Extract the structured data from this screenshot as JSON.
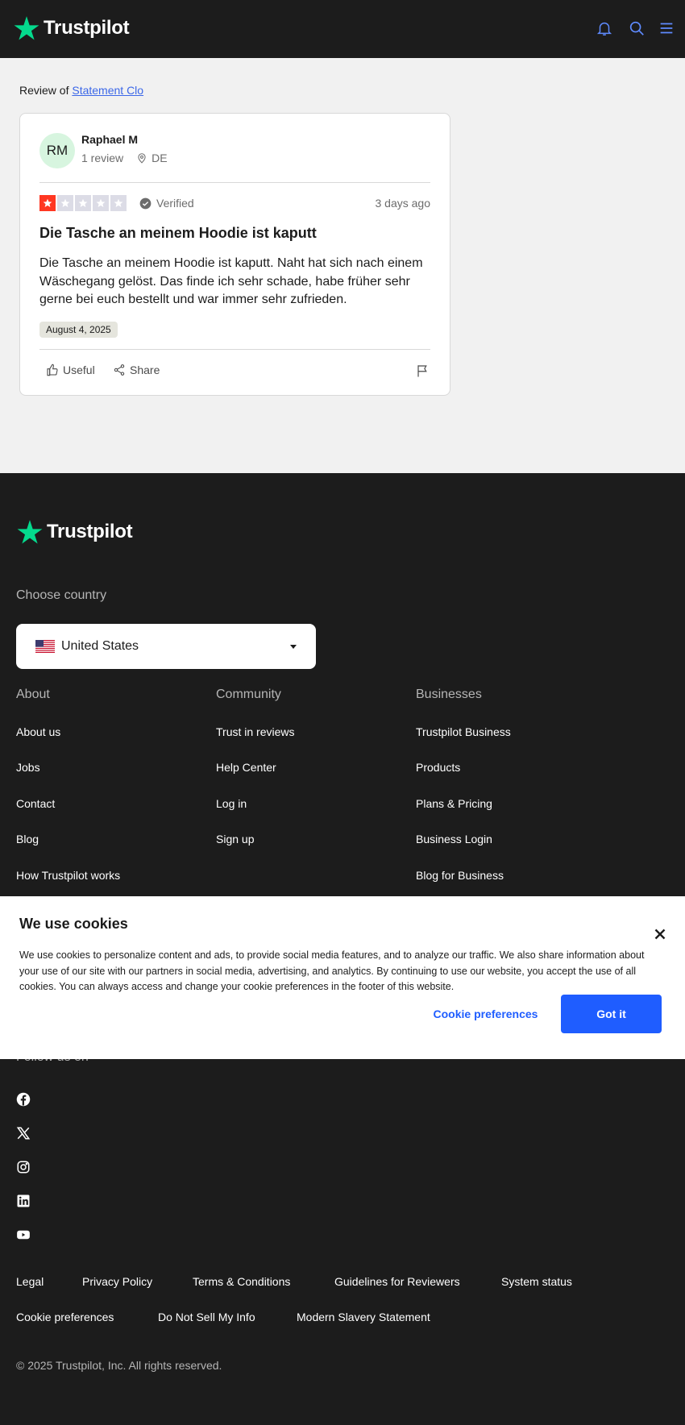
{
  "header": {
    "logo_text": "Trustpilot",
    "icons": [
      "bell-icon",
      "search-icon",
      "menu-icon"
    ],
    "accent_color": "#04da8d"
  },
  "main": {
    "review_of_prefix": "Review of",
    "company_link": "Statement Clo",
    "reviewer": {
      "initials": "RM",
      "name": "Raphael M",
      "review_count": "1 review",
      "country": "DE"
    },
    "rating": 1,
    "rating_max": 5,
    "verified_label": "Verified",
    "posted_ago": "3 days ago",
    "title": "Die Tasche an meinem Hoodie ist kaputt",
    "body": "Die Tasche an meinem Hoodie ist kaputt. Naht hat sich nach einem Wäschegang gelöst. Das finde ich sehr schade, habe früher sehr gerne bei euch bestellt und war immer sehr zufrieden.",
    "date_of_experience": "August 4, 2025",
    "useful_label": "Useful",
    "share_label": "Share"
  },
  "footer": {
    "logo_text": "Trustpilot",
    "choose_country": "Choose country",
    "selected_country": "United States",
    "columns": [
      {
        "heading": "About",
        "links": [
          "About us",
          "Jobs",
          "Contact",
          "Blog",
          "How Trustpilot works"
        ]
      },
      {
        "heading": "Community",
        "links": [
          "Trust in reviews",
          "Help Center",
          "Log in",
          "Sign up"
        ]
      },
      {
        "heading": "Businesses",
        "links": [
          "Trustpilot Business",
          "Products",
          "Plans & Pricing",
          "Business Login",
          "Blog for Business"
        ]
      }
    ],
    "follow_label": "Follow us on",
    "social_icons": [
      "facebook-icon",
      "x-icon",
      "instagram-icon",
      "linkedin-icon",
      "youtube-icon"
    ],
    "legal_row1": [
      "Legal",
      "Privacy Policy",
      "Terms & Conditions",
      "Guidelines for Reviewers",
      "System status"
    ],
    "legal_row2": [
      "Cookie preferences",
      "Do Not Sell My Info",
      "Modern Slavery Statement"
    ],
    "copyright": "© 2025 Trustpilot, Inc. All rights reserved."
  },
  "cookie_banner": {
    "title": "We use cookies",
    "text": "We use cookies to personalize content and ads, to provide social media features, and to analyze our traffic. We also share information about your use of our site with our partners in social media, advertising, and analytics. By continuing to use our website, you accept the use of all cookies. You can always access and change your cookie preferences in the footer of this website.",
    "preferences_label": "Cookie preferences",
    "accept_label": "Got it",
    "accept_color": "#1f5dff"
  }
}
